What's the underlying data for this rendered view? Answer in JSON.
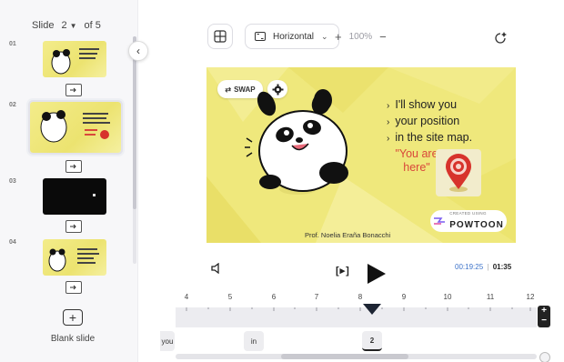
{
  "sidebar": {
    "slide_label": "Slide",
    "current_slide": "2",
    "of_total": "of 5",
    "thumbs": [
      {
        "num": "01"
      },
      {
        "num": "02"
      },
      {
        "num": "03"
      },
      {
        "num": "04"
      }
    ],
    "blank_slide_label": "Blank slide"
  },
  "toolbar": {
    "orientation": "Horizontal",
    "zoom_level": "100%",
    "zoom_in": "+",
    "zoom_out": "−"
  },
  "canvas": {
    "swap_label": "SWAP",
    "bullets": [
      "I'll show you",
      "your position",
      "in the site map."
    ],
    "you_are_line1": "\"You are",
    "you_are_line2": "here\"",
    "credit": "Prof. Noelia Eraña Bonacchi",
    "badge_small": "CREATED USING",
    "badge_brand": "POWTOON"
  },
  "playback": {
    "step_label": "[▸]",
    "current_time": "00:19:25",
    "separator": "|",
    "total_time": "01:35"
  },
  "timeline": {
    "ticks": [
      "4",
      "5",
      "6",
      "7",
      "8",
      "9",
      "10",
      "11",
      "12"
    ],
    "chips": [
      "you",
      "in",
      "2"
    ],
    "zoom_plus": "+",
    "zoom_minus": "−"
  },
  "colors": {
    "slide_bg": "#efe87c",
    "accent_blue": "#3d73c9",
    "you_are_red": "#d9483b",
    "pin_red": "#d7332c"
  }
}
